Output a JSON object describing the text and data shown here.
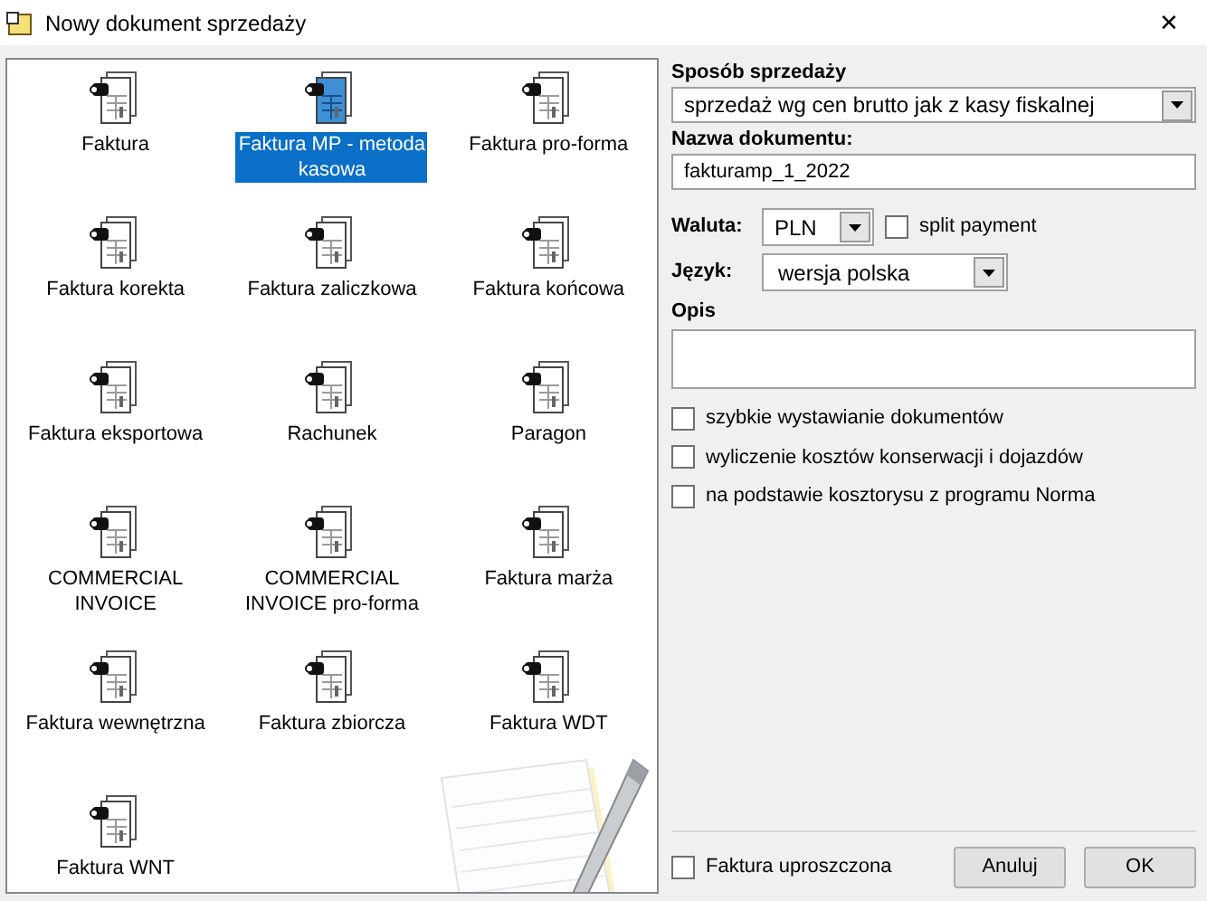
{
  "window": {
    "title": "Nowy dokument sprzedaży",
    "close": "✕"
  },
  "documents": [
    {
      "label": "Faktura",
      "selected": false
    },
    {
      "label": "Faktura MP - metoda kasowa",
      "selected": true
    },
    {
      "label": "Faktura pro-forma",
      "selected": false
    },
    {
      "label": "Faktura korekta",
      "selected": false
    },
    {
      "label": "Faktura zaliczkowa",
      "selected": false
    },
    {
      "label": "Faktura końcowa",
      "selected": false
    },
    {
      "label": "Faktura eksportowa",
      "selected": false
    },
    {
      "label": "Rachunek",
      "selected": false
    },
    {
      "label": "Paragon",
      "selected": false
    },
    {
      "label": "COMMERCIAL INVOICE",
      "selected": false
    },
    {
      "label": "COMMERCIAL INVOICE pro-forma",
      "selected": false
    },
    {
      "label": "Faktura marża",
      "selected": false
    },
    {
      "label": "Faktura wewnętrzna",
      "selected": false
    },
    {
      "label": "Faktura zbiorcza",
      "selected": false
    },
    {
      "label": "Faktura WDT",
      "selected": false
    },
    {
      "label": "Faktura WNT",
      "selected": false
    }
  ],
  "sales_method": {
    "label": "Sposób sprzedaży",
    "value": "sprzedaż wg cen brutto jak z kasy fiskalnej"
  },
  "document_name": {
    "label": "Nazwa dokumentu:",
    "value": "fakturamp_1_2022"
  },
  "currency": {
    "label": "Waluta:",
    "value": "PLN"
  },
  "split_payment": {
    "label": "split payment",
    "checked": false
  },
  "language": {
    "label": "Język:",
    "value": "wersja polska"
  },
  "description": {
    "label": "Opis"
  },
  "options": [
    {
      "label": "szybkie wystawianie dokumentów",
      "checked": false
    },
    {
      "label": "wyliczenie kosztów konserwacji i dojazdów",
      "checked": false
    },
    {
      "label": "na podstawie kosztorysu z programu Norma",
      "checked": false
    }
  ],
  "simplified_invoice": {
    "label": "Faktura uproszczona",
    "checked": false
  },
  "buttons": [
    "Anuluj",
    "OK"
  ]
}
